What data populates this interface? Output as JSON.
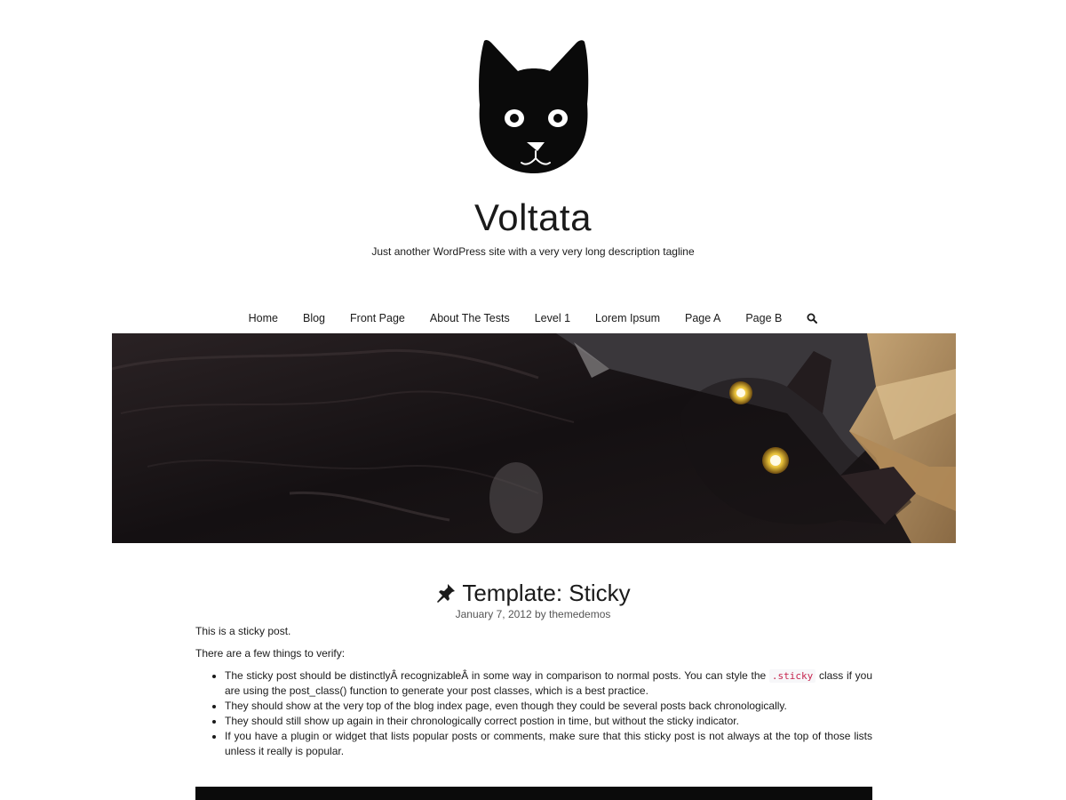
{
  "site": {
    "title": "Voltata",
    "tagline": "Just another WordPress site with a very very long description tagline",
    "logo_icon": "cat-head-logo-icon"
  },
  "nav": {
    "items": [
      {
        "label": "Home"
      },
      {
        "label": "Blog"
      },
      {
        "label": "Front Page"
      },
      {
        "label": "About The Tests"
      },
      {
        "label": "Level 1"
      },
      {
        "label": "Lorem Ipsum"
      },
      {
        "label": "Page A"
      },
      {
        "label": "Page B"
      }
    ],
    "search_icon": "search-icon"
  },
  "hero": {
    "icon": "black-cat-header-image"
  },
  "post": {
    "sticky_icon": "pushpin-icon",
    "title": "Template: Sticky",
    "date": "January 7, 2012",
    "by": "by",
    "author": "themedemos",
    "intro": "This is a sticky post.",
    "lead": "There are a few things to verify:",
    "bullets": [
      {
        "before": "The sticky post should be distinctlyÂ recognizableÂ in some way in comparison to normal posts. You can style the ",
        "code": ".sticky",
        "after": " class if you are using the post_class() function to generate your post classes, which is a best practice."
      },
      {
        "text": "They should show at the very top of the blog index page, even though they could be several posts back chronologically."
      },
      {
        "text": "They should still show up again in their chronologically correct postion in time, but without the sticky indicator."
      },
      {
        "text": "If you have a plugin or widget that lists popular posts or comments, make sure that this sticky post is not always at the top of those lists unless it really is popular."
      }
    ]
  },
  "colors": {
    "text": "#1a1a1a",
    "meta": "#555555",
    "code": "#c7254e",
    "background": "#ffffff"
  }
}
